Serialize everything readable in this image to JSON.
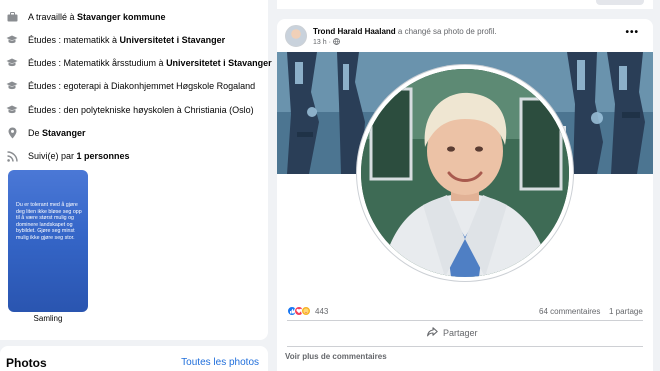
{
  "intro": {
    "items": [
      {
        "icon": "briefcase-icon",
        "prefix": "A travaillé à ",
        "bold": "Stavanger kommune",
        "suffix": ""
      },
      {
        "icon": "graduation-cap-icon",
        "prefix": "Études : matematikk à ",
        "bold": "Universitetet i Stavanger",
        "suffix": ""
      },
      {
        "icon": "graduation-cap-icon",
        "prefix": "Études : Matematikk årsstudium à ",
        "bold": "Universitetet i Stavanger",
        "suffix": ""
      },
      {
        "icon": "graduation-cap-icon",
        "prefix": "Études : egoterapi à Diakonhjemmet Høgskole Rogaland",
        "bold": "",
        "suffix": ""
      },
      {
        "icon": "graduation-cap-icon",
        "prefix": "Études : den polytekniske høyskolen à Christiania (Oslo)",
        "bold": "",
        "suffix": ""
      },
      {
        "icon": "location-pin-icon",
        "prefix": "De ",
        "bold": "Stavanger",
        "suffix": ""
      },
      {
        "icon": "rss-icon",
        "prefix": "Suivi(e) par ",
        "bold": "1 personnes",
        "suffix": ""
      }
    ],
    "story_text": "Du er tolerant med å gjøre deg liten ikke bløse seg opp til å være størst mulig og dominere landskapet og bybildet. Gjøre seg minst mulig ikke gjøre seg stor.",
    "story_label": "Samling"
  },
  "photos": {
    "title": "Photos",
    "link": "Toutes les photos"
  },
  "post": {
    "author": "Trond Harald Haaland",
    "action": " a changé sa photo de profil.",
    "time": "13 h",
    "privacy_icon": "globe-icon",
    "reaction_count": "443",
    "comments": "64 commentaires",
    "shares": "1 partage",
    "share_label": "Partager",
    "more_comments": "Voir plus de commentaires"
  },
  "colors": {
    "link": "#216fdb",
    "secondary_text": "#65676b",
    "like": "#1877f2",
    "love": "#f33e58",
    "care": "#f7b125"
  }
}
